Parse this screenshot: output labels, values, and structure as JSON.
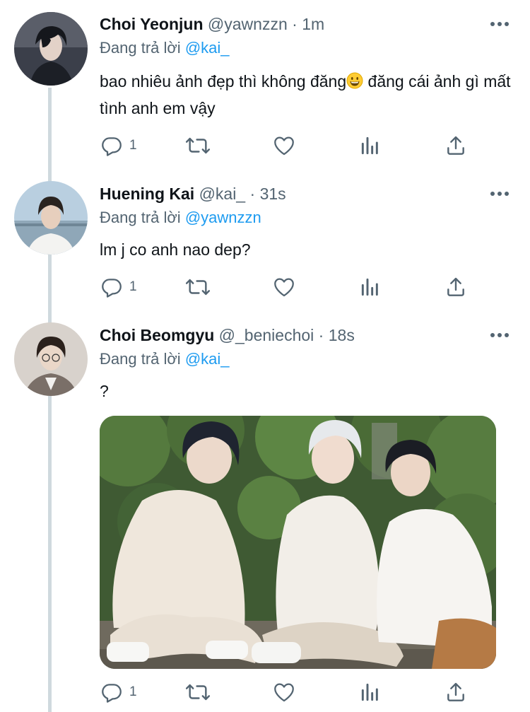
{
  "tweets": [
    {
      "name": "Choi Yeonjun",
      "handle": "@yawnzzn",
      "separator": "·",
      "time": "1m",
      "reply_prefix": "Đang trả lời",
      "reply_to": "@kai_",
      "text_part1": "bao nhiêu ảnh đẹp thì không đăng",
      "emoji": "grinning-face",
      "text_part2": " đăng cái ảnh gì mất tình anh em vậy",
      "reply_count": "1",
      "retweet_count": "",
      "like_count": ""
    },
    {
      "name": "Huening Kai",
      "handle": "@kai_",
      "separator": "·",
      "time": "31s",
      "reply_prefix": "Đang trả lời",
      "reply_to": "@yawnzzn",
      "text": "lm j co anh nao dep?",
      "reply_count": "1",
      "retweet_count": "",
      "like_count": ""
    },
    {
      "name": "Choi Beomgyu",
      "handle": "@_beniechoi",
      "separator": "·",
      "time": "18s",
      "reply_prefix": "Đang trả lời",
      "reply_to": "@kai_",
      "text": "?",
      "has_media": true,
      "reply_count": "1",
      "retweet_count": "",
      "like_count": ""
    }
  ],
  "icons": {
    "more": "more-icon",
    "reply": "reply-icon",
    "retweet": "retweet-icon",
    "like": "like-icon",
    "analytics": "analytics-icon",
    "share": "share-icon"
  },
  "colors": {
    "link": "#1d9bf0",
    "secondary_text": "#536471",
    "thread_line": "#cfd9de"
  }
}
